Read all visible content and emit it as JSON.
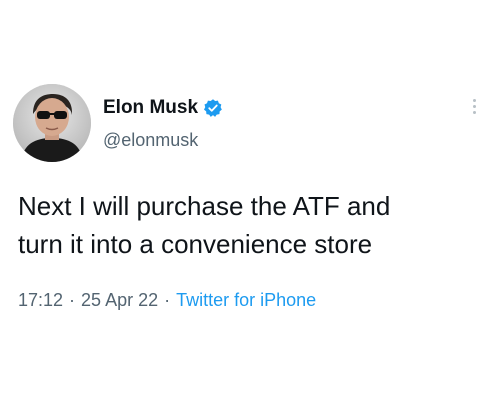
{
  "user": {
    "display_name": "Elon Musk",
    "handle": "@elonmusk",
    "verified": true,
    "verified_color": "#1d9bf0",
    "avatar_icon": "profile-photo"
  },
  "tweet": {
    "text_line1": "Next I will purchase the ATF and",
    "text_line2": "turn it into a convenience store"
  },
  "meta": {
    "time": "17:12",
    "separator": "·",
    "date": "25 Apr 22",
    "source": "Twitter for iPhone",
    "source_color": "#1d9bf0"
  },
  "more_icon": "more-vertical-icon"
}
